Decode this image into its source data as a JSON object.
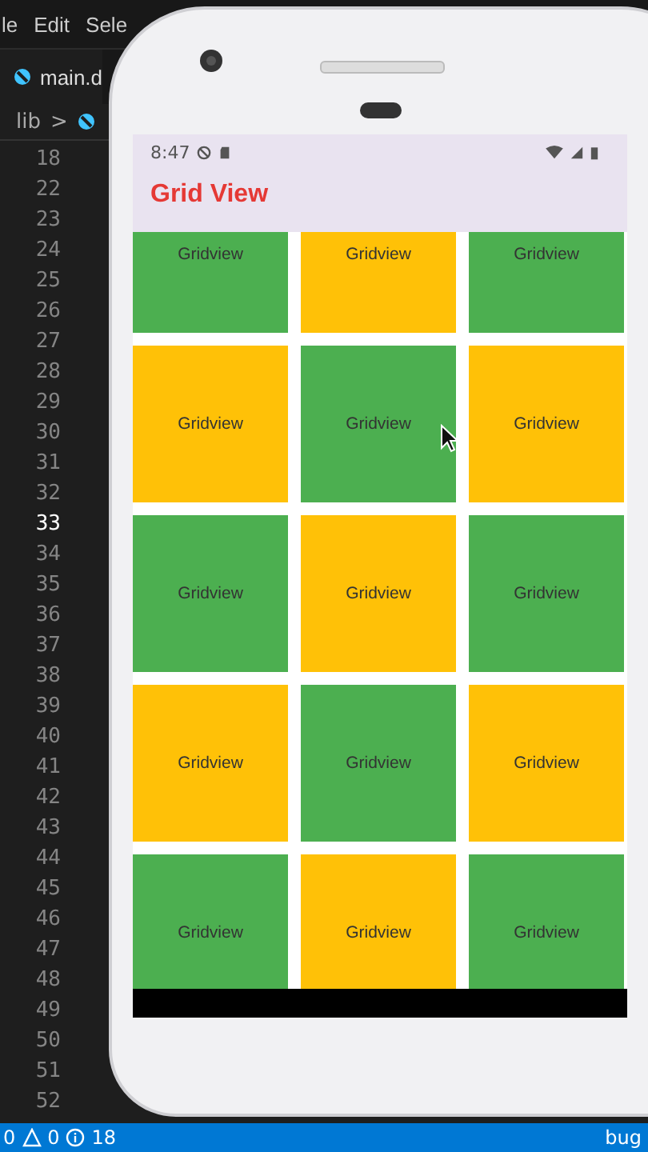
{
  "menu": [
    "le",
    "Edit",
    "Sele"
  ],
  "tab": {
    "label": "main.d"
  },
  "breadcrumb": [
    "lib",
    ">"
  ],
  "gutter": [
    {
      "number": "18",
      "current": false
    },
    {
      "number": "22",
      "current": false
    },
    {
      "number": "23",
      "current": false
    },
    {
      "number": "24",
      "current": false
    },
    {
      "number": "25",
      "current": false
    },
    {
      "number": "26",
      "current": false
    },
    {
      "number": "27",
      "current": false
    },
    {
      "number": "28",
      "current": false
    },
    {
      "number": "29",
      "current": false
    },
    {
      "number": "30",
      "current": false
    },
    {
      "number": "31",
      "current": false
    },
    {
      "number": "32",
      "current": false
    },
    {
      "number": "33",
      "current": true
    },
    {
      "number": "34",
      "current": false
    },
    {
      "number": "35",
      "current": false
    },
    {
      "number": "36",
      "current": false
    },
    {
      "number": "37",
      "current": false
    },
    {
      "number": "38",
      "current": false
    },
    {
      "number": "39",
      "current": false
    },
    {
      "number": "40",
      "current": false
    },
    {
      "number": "41",
      "current": false
    },
    {
      "number": "42",
      "current": false
    },
    {
      "number": "43",
      "current": false
    },
    {
      "number": "44",
      "current": false
    },
    {
      "number": "45",
      "current": false
    },
    {
      "number": "46",
      "current": false
    },
    {
      "number": "47",
      "current": false
    },
    {
      "number": "48",
      "current": false
    },
    {
      "number": "49",
      "current": false
    },
    {
      "number": "50",
      "current": false
    },
    {
      "number": "51",
      "current": false
    },
    {
      "number": "52",
      "current": false
    }
  ],
  "status_bar": {
    "errors": "0",
    "warnings": "0",
    "infos": "18",
    "right": "bug"
  },
  "phone": {
    "time": "8:47",
    "title": "Grid View",
    "cells": [
      {
        "label": "Gridview",
        "color": "#4caf50"
      },
      {
        "label": "Gridview",
        "color": "#ffc107"
      },
      {
        "label": "Gridview",
        "color": "#4caf50"
      },
      {
        "label": "Gridview",
        "color": "#ffc107"
      },
      {
        "label": "Gridview",
        "color": "#4caf50"
      },
      {
        "label": "Gridview",
        "color": "#ffc107"
      },
      {
        "label": "Gridview",
        "color": "#4caf50"
      },
      {
        "label": "Gridview",
        "color": "#ffc107"
      },
      {
        "label": "Gridview",
        "color": "#4caf50"
      },
      {
        "label": "Gridview",
        "color": "#ffc107"
      },
      {
        "label": "Gridview",
        "color": "#4caf50"
      },
      {
        "label": "Gridview",
        "color": "#ffc107"
      },
      {
        "label": "Gridview",
        "color": "#4caf50"
      },
      {
        "label": "Gridview",
        "color": "#ffc107"
      },
      {
        "label": "Gridview",
        "color": "#4caf50"
      }
    ]
  }
}
